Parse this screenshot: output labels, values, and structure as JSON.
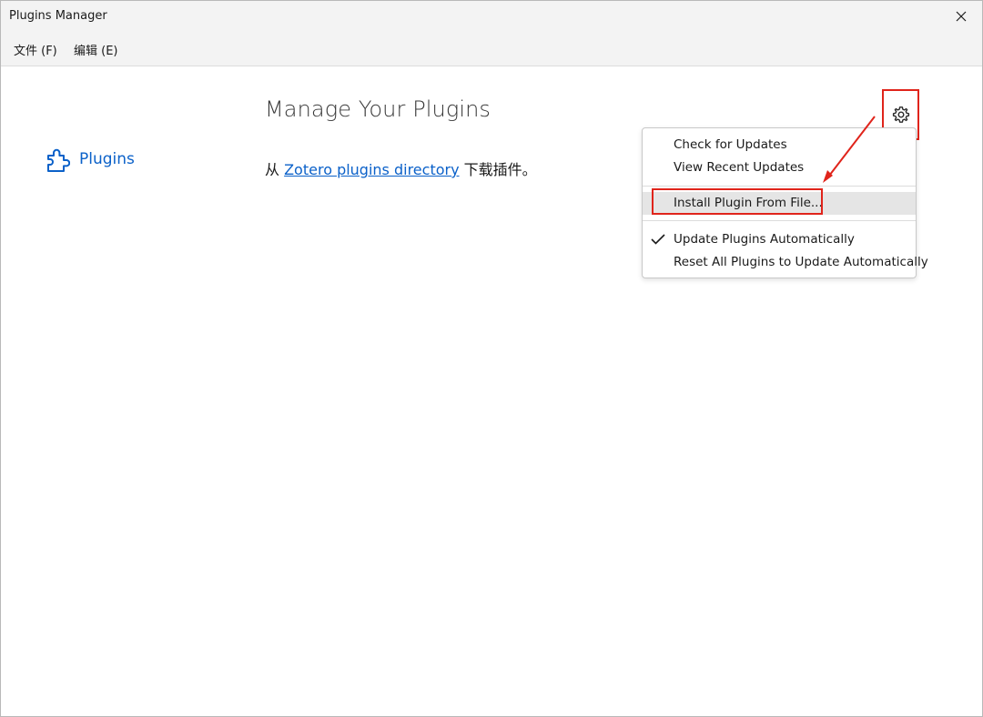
{
  "window": {
    "title": "Plugins Manager"
  },
  "menubar": {
    "file": "文件 (F)",
    "edit": "编辑 (E)"
  },
  "sidebar": {
    "items": [
      {
        "label": "Plugins"
      }
    ]
  },
  "main": {
    "heading": "Manage Your Plugins",
    "intro_prefix": "从 ",
    "intro_link": "Zotero plugins directory",
    "intro_suffix": " 下载插件。"
  },
  "gear_menu": {
    "items": [
      {
        "label": "Check for Updates"
      },
      {
        "label": "View Recent Updates"
      },
      {
        "label": "Install Plugin From File..."
      },
      {
        "label": "Update Plugins Automatically",
        "checked": true
      },
      {
        "label": "Reset All Plugins to Update Automatically"
      }
    ]
  },
  "colors": {
    "accent": "#0b61c9",
    "annotation": "#e0241b",
    "hover": "#e5e5e5"
  }
}
